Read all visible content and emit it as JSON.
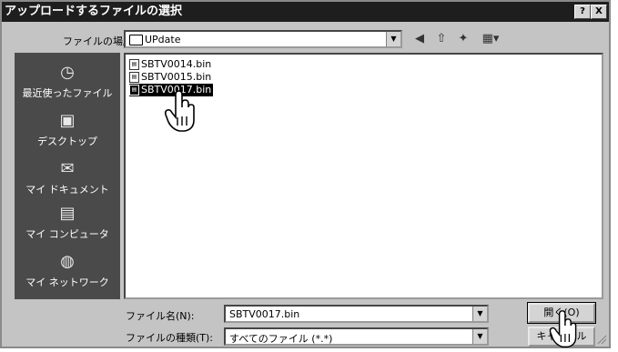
{
  "window": {
    "title": "アップロードするファイルの選択",
    "help_label": "?",
    "close_label": "X"
  },
  "lookin": {
    "label": "ファイルの場所(I):",
    "value": "UPdate"
  },
  "toolbar": {
    "back_icon": "back-icon",
    "up_icon": "up-folder-icon",
    "newfolder_icon": "new-folder-icon",
    "view_icon": "view-menu-icon"
  },
  "places": [
    {
      "label": "最近使ったファイル",
      "icon": "recent-icon"
    },
    {
      "label": "デスクトップ",
      "icon": "desktop-icon"
    },
    {
      "label": "マイ ドキュメント",
      "icon": "my-documents-icon"
    },
    {
      "label": "マイ コンピュータ",
      "icon": "my-computer-icon"
    },
    {
      "label": "マイ ネットワーク",
      "icon": "my-network-icon"
    }
  ],
  "files": [
    {
      "name": "SBTV0014.bin",
      "selected": false
    },
    {
      "name": "SBTV0015.bin",
      "selected": false
    },
    {
      "name": "SBTV0017.bin",
      "selected": true
    }
  ],
  "filename": {
    "label": "ファイル名(N):",
    "value": "SBTV0017.bin"
  },
  "filetype": {
    "label": "ファイルの種類(T):",
    "value": "すべてのファイル (*.*)"
  },
  "buttons": {
    "open_label": "開く(O)",
    "cancel_label": "キャンセル"
  }
}
